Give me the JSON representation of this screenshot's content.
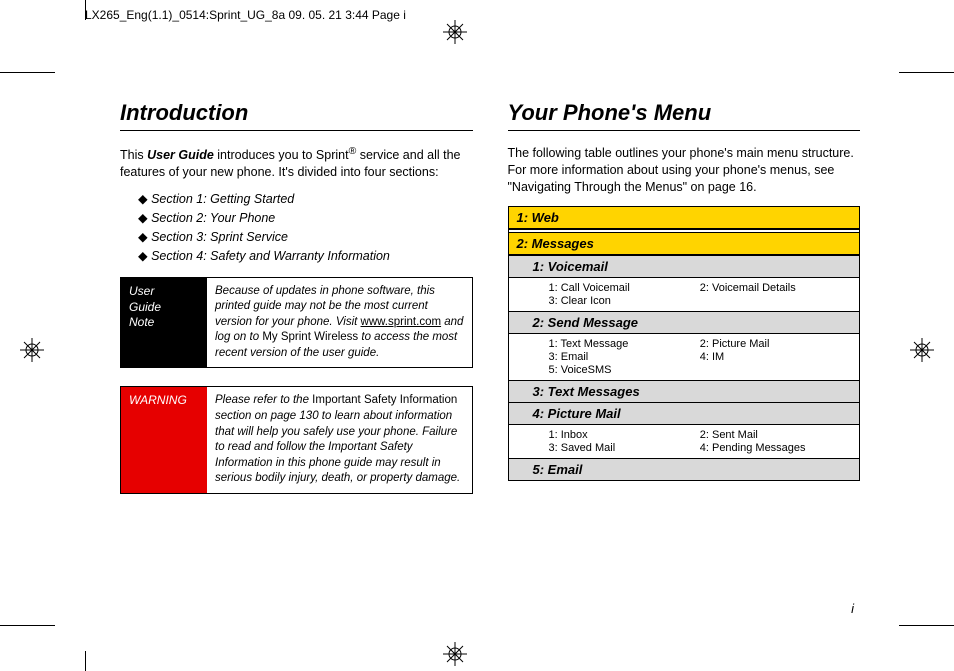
{
  "header": "LX265_Eng(1.1)_0514:Sprint_UG_8a  09. 05. 21    3:44  Page i",
  "left": {
    "title": "Introduction",
    "intro_a": "This ",
    "intro_b": "User Guide",
    "intro_c": " introduces you to Sprint",
    "intro_d": " service and all the features of your new phone. It's divided into four sections:",
    "sections": [
      "Section 1:  Getting Started",
      "Section 2:  Your Phone",
      "Section 3:  Sprint Service",
      "Section 4:  Safety and Warranty Information"
    ],
    "note1_label_a": "User",
    "note1_label_b": "Guide",
    "note1_label_c": "Note",
    "note1_body_a": "Because of updates in phone software, this printed guide may not be the most current version for your phone. Visit ",
    "note1_link": "www.sprint.com",
    "note1_body_b": " and log on to ",
    "note1_bold": "My Sprint Wireless",
    "note1_body_c": " to access the most recent version of the user guide.",
    "note2_label": "WARNING",
    "note2_body_a": "Please refer to the ",
    "note2_bold": "Important Safety Information",
    "note2_body_b": " section on page 130 to learn about information that will help you safely use your phone. Failure to read and follow the Important Safety Information in this phone guide may result in serious bodily injury, death, or property damage."
  },
  "right": {
    "title": "Your Phone's Menu",
    "intro": "The following table outlines your phone's main menu structure. For more information about using your phone's menus, see \"Navigating Through the Menus\" on page 16.",
    "rows": {
      "web": "1: Web",
      "messages": "2: Messages",
      "voicemail": "1: Voicemail",
      "vm_items": [
        "1: Call Voicemail",
        "2: Voicemail Details",
        "3: Clear Icon"
      ],
      "send": "2: Send Message",
      "send_items": [
        "1: Text Message",
        "2: Picture Mail",
        "3: Email",
        "4: IM",
        "5: VoiceSMS"
      ],
      "text": "3: Text Messages",
      "picmail": "4: Picture Mail",
      "pm_items": [
        "1: Inbox",
        "2: Sent Mail",
        "3: Saved Mail",
        "4: Pending Messages"
      ],
      "email": "5: Email"
    }
  },
  "page_num": "i"
}
